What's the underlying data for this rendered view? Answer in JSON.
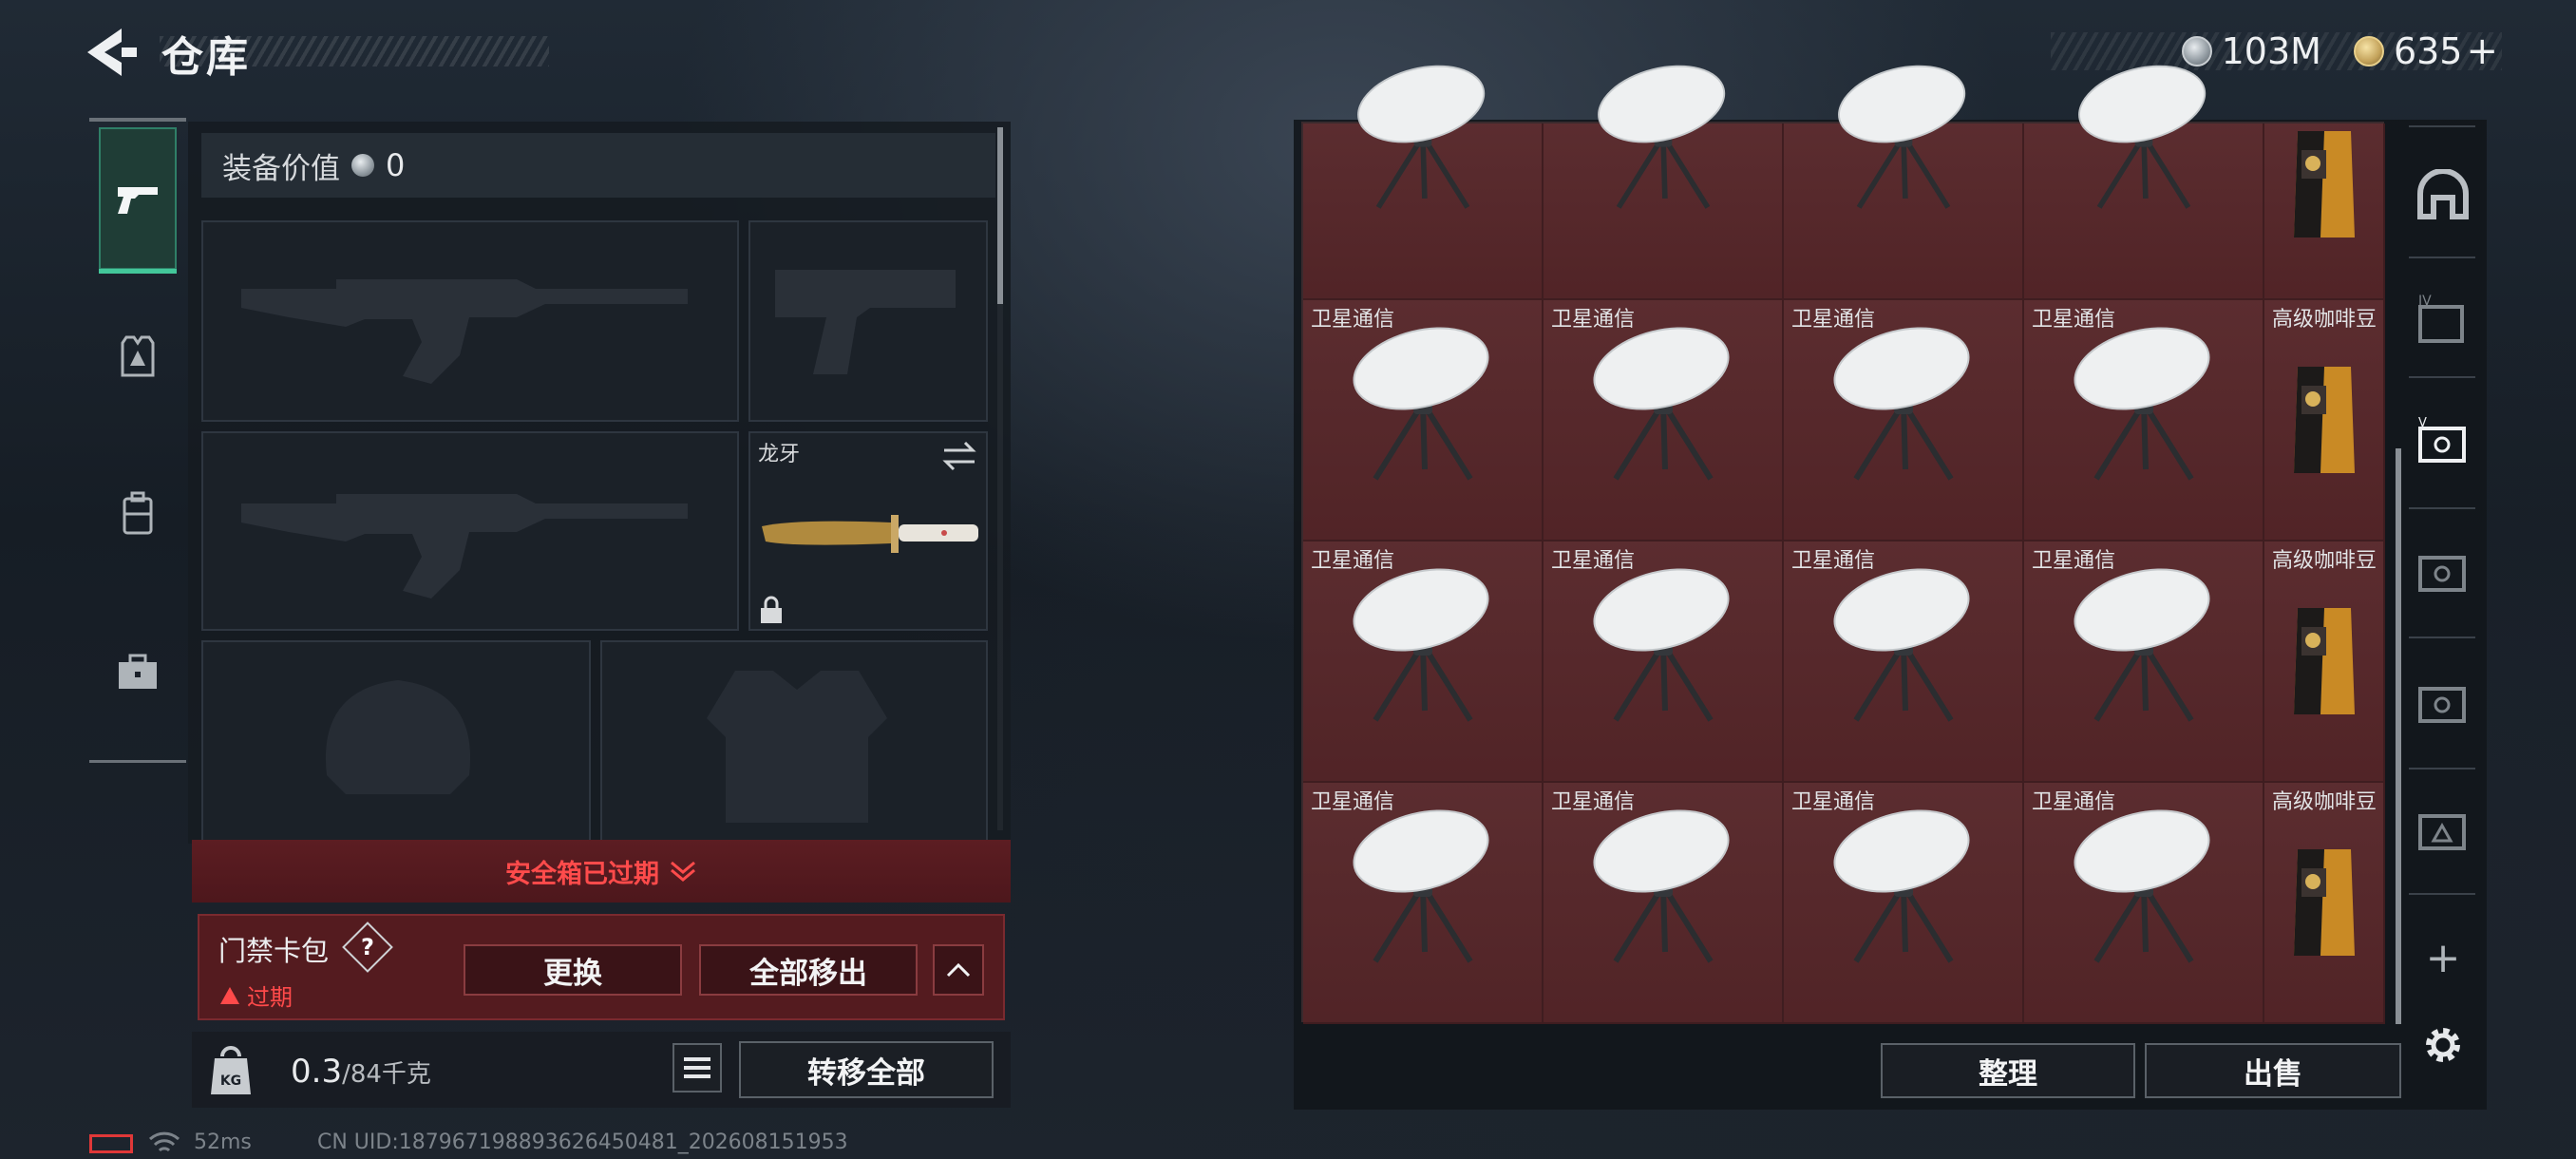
{
  "header": {
    "title": "仓库",
    "currencies": [
      {
        "icon": "silver-coin-icon",
        "value": "103M"
      },
      {
        "icon": "gold-coin-icon",
        "value": "635"
      }
    ],
    "add_symbol": "+"
  },
  "left_nav": {
    "items": [
      {
        "name": "weapon-tab",
        "icon": "pistol-icon",
        "active": true
      },
      {
        "name": "armor-tab",
        "icon": "armor-icon",
        "active": false
      },
      {
        "name": "backpack-tab",
        "icon": "backpack-icon",
        "active": false
      },
      {
        "name": "case-tab",
        "icon": "briefcase-icon",
        "active": false
      }
    ]
  },
  "equipment": {
    "value_label": "装备价值",
    "value": "0",
    "melee_slot_label": "龙牙"
  },
  "secure_case": {
    "banner": "安全箱已过期",
    "card_title": "门禁卡包",
    "help": "?",
    "status": "过期",
    "replace_button": "更换",
    "remove_all_button": "全部移出"
  },
  "weight": {
    "current": "0.3",
    "capacity": "/84千克",
    "transfer_all_button": "转移全部"
  },
  "storage": {
    "rows": [
      [
        "",
        "",
        "",
        "",
        ""
      ],
      [
        "卫星通信",
        "卫星通信",
        "卫星通信",
        "卫星通信",
        "高级咖啡豆"
      ],
      [
        "卫星通信",
        "卫星通信",
        "卫星通信",
        "卫星通信",
        "高级咖啡豆"
      ],
      [
        "卫星通信",
        "卫星通信",
        "卫星通信",
        "卫星通信",
        "高级咖啡豆"
      ]
    ],
    "sort_button": "整理",
    "sell_button": "出售"
  },
  "right_tabs": {
    "items": [
      "vault-tab",
      "storage-iv-tab",
      "storage-v-tab-active",
      "storage-v-tab",
      "storage-v-tab-2",
      "storage-iii-tab"
    ],
    "add_symbol": "+"
  },
  "footer": {
    "ping": "52ms",
    "uid": "CN UID:1879671988936264504​81_202608151953"
  },
  "colors": {
    "accent_green": "#43c79a",
    "danger_red": "#ff4b4b",
    "cell_red": "#562629"
  }
}
